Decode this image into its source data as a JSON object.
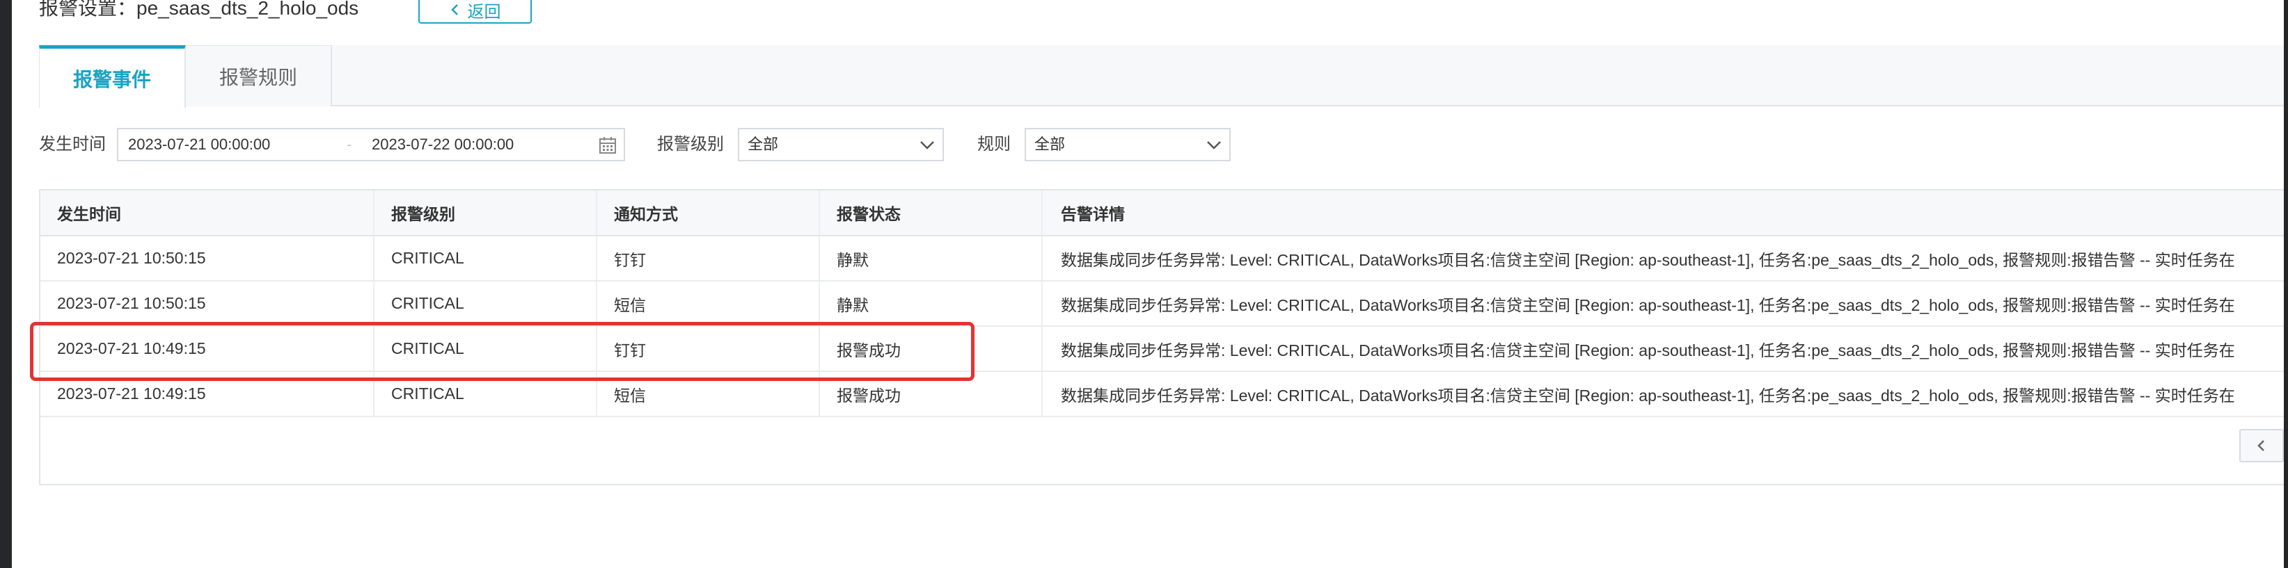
{
  "header": {
    "title": "报警设置：pe_saas_dts_2_holo_ods",
    "back_label": "返回"
  },
  "tabs": [
    {
      "label": "报警事件",
      "active": true
    },
    {
      "label": "报警规则",
      "active": false
    }
  ],
  "filters": {
    "time_label": "发生时间",
    "start_date": "2023-07-21 00:00:00",
    "range_separator": "-",
    "end_date": "2023-07-22 00:00:00",
    "level_label": "报警级别",
    "level_value": "全部",
    "rule_label": "规则",
    "rule_value": "全部"
  },
  "table": {
    "columns": [
      "发生时间",
      "报警级别",
      "通知方式",
      "报警状态",
      "告警详情"
    ],
    "rows": [
      [
        "2023-07-21 10:50:15",
        "CRITICAL",
        "钉钉",
        "静默",
        "数据集成同步任务异常: Level: CRITICAL, DataWorks项目名:信贷主空间 [Region: ap-southeast-1], 任务名:pe_saas_dts_2_holo_ods, 报警规则:报错告警 -- 实时任务在"
      ],
      [
        "2023-07-21 10:50:15",
        "CRITICAL",
        "短信",
        "静默",
        "数据集成同步任务异常: Level: CRITICAL, DataWorks项目名:信贷主空间 [Region: ap-southeast-1], 任务名:pe_saas_dts_2_holo_ods, 报警规则:报错告警 -- 实时任务在"
      ],
      [
        "2023-07-21 10:49:15",
        "CRITICAL",
        "钉钉",
        "报警成功",
        "数据集成同步任务异常: Level: CRITICAL, DataWorks项目名:信贷主空间 [Region: ap-southeast-1], 任务名:pe_saas_dts_2_holo_ods, 报警规则:报错告警 -- 实时任务在"
      ],
      [
        "2023-07-21 10:49:15",
        "CRITICAL",
        "短信",
        "报警成功",
        "数据集成同步任务异常: Level: CRITICAL, DataWorks项目名:信贷主空间 [Region: ap-southeast-1], 任务名:pe_saas_dts_2_holo_ods, 报警规则:报错告警 -- 实时任务在"
      ]
    ]
  },
  "colors": {
    "accent": "#19a3c4",
    "highlight": "#e43232"
  }
}
